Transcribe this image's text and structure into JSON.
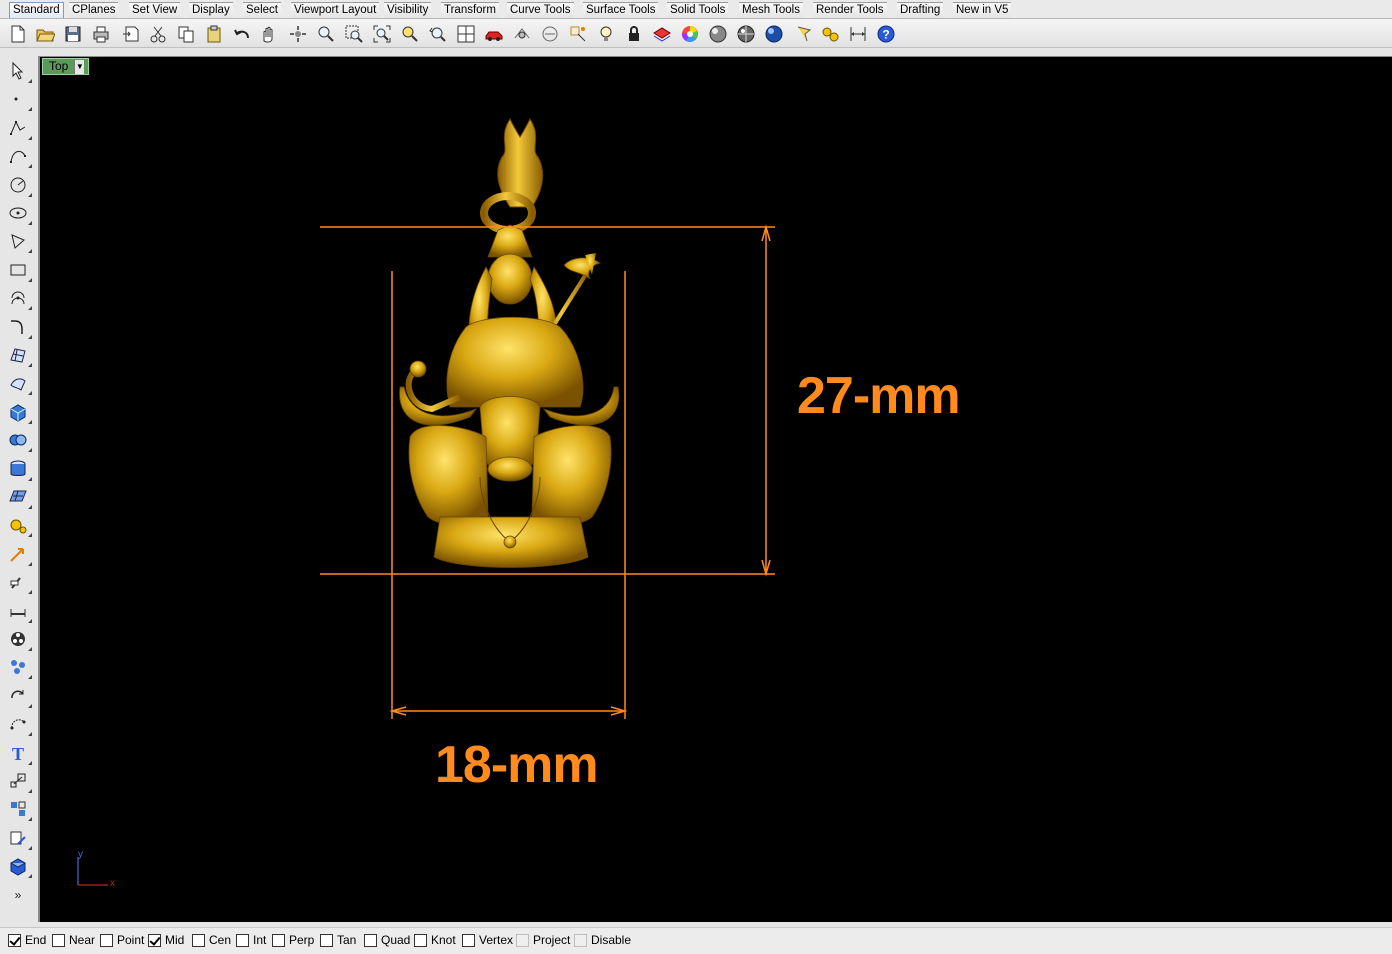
{
  "tabs": [
    "Standard",
    "CPlanes",
    "Set View",
    "Display",
    "Select",
    "Viewport Layout",
    "Visibility",
    "Transform",
    "Curve Tools",
    "Surface Tools",
    "Solid Tools",
    "Mesh Tools",
    "Render Tools",
    "Drafting",
    "New in V5"
  ],
  "active_tab": "Standard",
  "viewport": {
    "name": "Top",
    "axis_x": "x",
    "axis_y": "y",
    "dim_height_label": "27-mm",
    "dim_width_label": "18-mm",
    "dim_color": "#ff8a1e",
    "model_color": "#d4a010"
  },
  "toolbar_icons": [
    "new-icon",
    "open-icon",
    "save-icon",
    "print-icon",
    "import-icon",
    "cut-icon",
    "copy-icon",
    "paste-icon",
    "undo-icon",
    "pan-icon",
    "rotate-view-icon",
    "zoom-dynamic-icon",
    "zoom-window-icon",
    "zoom-extents-icon",
    "zoom-selected-icon",
    "undo-view-icon",
    "four-viewports-icon",
    "car-icon",
    "grid-snap-icon",
    "cplane-icon",
    "osnap-icon",
    "light-icon",
    "lock-icon",
    "layer-icon",
    "color-wheel-icon",
    "sphere-shaded-icon",
    "sphere-rendered-icon",
    "sphere-blue-icon",
    "flag-icon",
    "settings-gears-icon",
    "dimension-icon",
    "help-icon"
  ],
  "left_tool_icons": [
    "select-arrow-icon",
    "point-icon",
    "polyline-icon",
    "curve-icon",
    "circle-icon",
    "ellipse-icon",
    "polygon-icon",
    "rectangle-icon",
    "arc-icon",
    "fillet-curve-icon",
    "surface-icon",
    "loft-icon",
    "box-solid-icon",
    "boolean-icon",
    "cylinder-icon",
    "mesh-plane-icon",
    "gears-icon",
    "transform-arrows-icon",
    "analyze-icon",
    "dim-line-icon",
    "render-icon",
    "group-icon",
    "rotate-icon",
    "array-icon",
    "text-icon",
    "scale-icon",
    "block-icon",
    "history-icon",
    "cube-icon",
    "more-icon"
  ],
  "osnaps": [
    {
      "label": "End",
      "checked": true,
      "enabled": true
    },
    {
      "label": "Near",
      "checked": false,
      "enabled": true
    },
    {
      "label": "Point",
      "checked": false,
      "enabled": true
    },
    {
      "label": "Mid",
      "checked": true,
      "enabled": true
    },
    {
      "label": "Cen",
      "checked": false,
      "enabled": true
    },
    {
      "label": "Int",
      "checked": false,
      "enabled": true
    },
    {
      "label": "Perp",
      "checked": false,
      "enabled": true
    },
    {
      "label": "Tan",
      "checked": false,
      "enabled": true
    },
    {
      "label": "Quad",
      "checked": false,
      "enabled": true
    },
    {
      "label": "Knot",
      "checked": false,
      "enabled": true
    },
    {
      "label": "Vertex",
      "checked": false,
      "enabled": true
    },
    {
      "label": "Project",
      "checked": false,
      "enabled": false
    },
    {
      "label": "Disable",
      "checked": false,
      "enabled": false
    }
  ]
}
